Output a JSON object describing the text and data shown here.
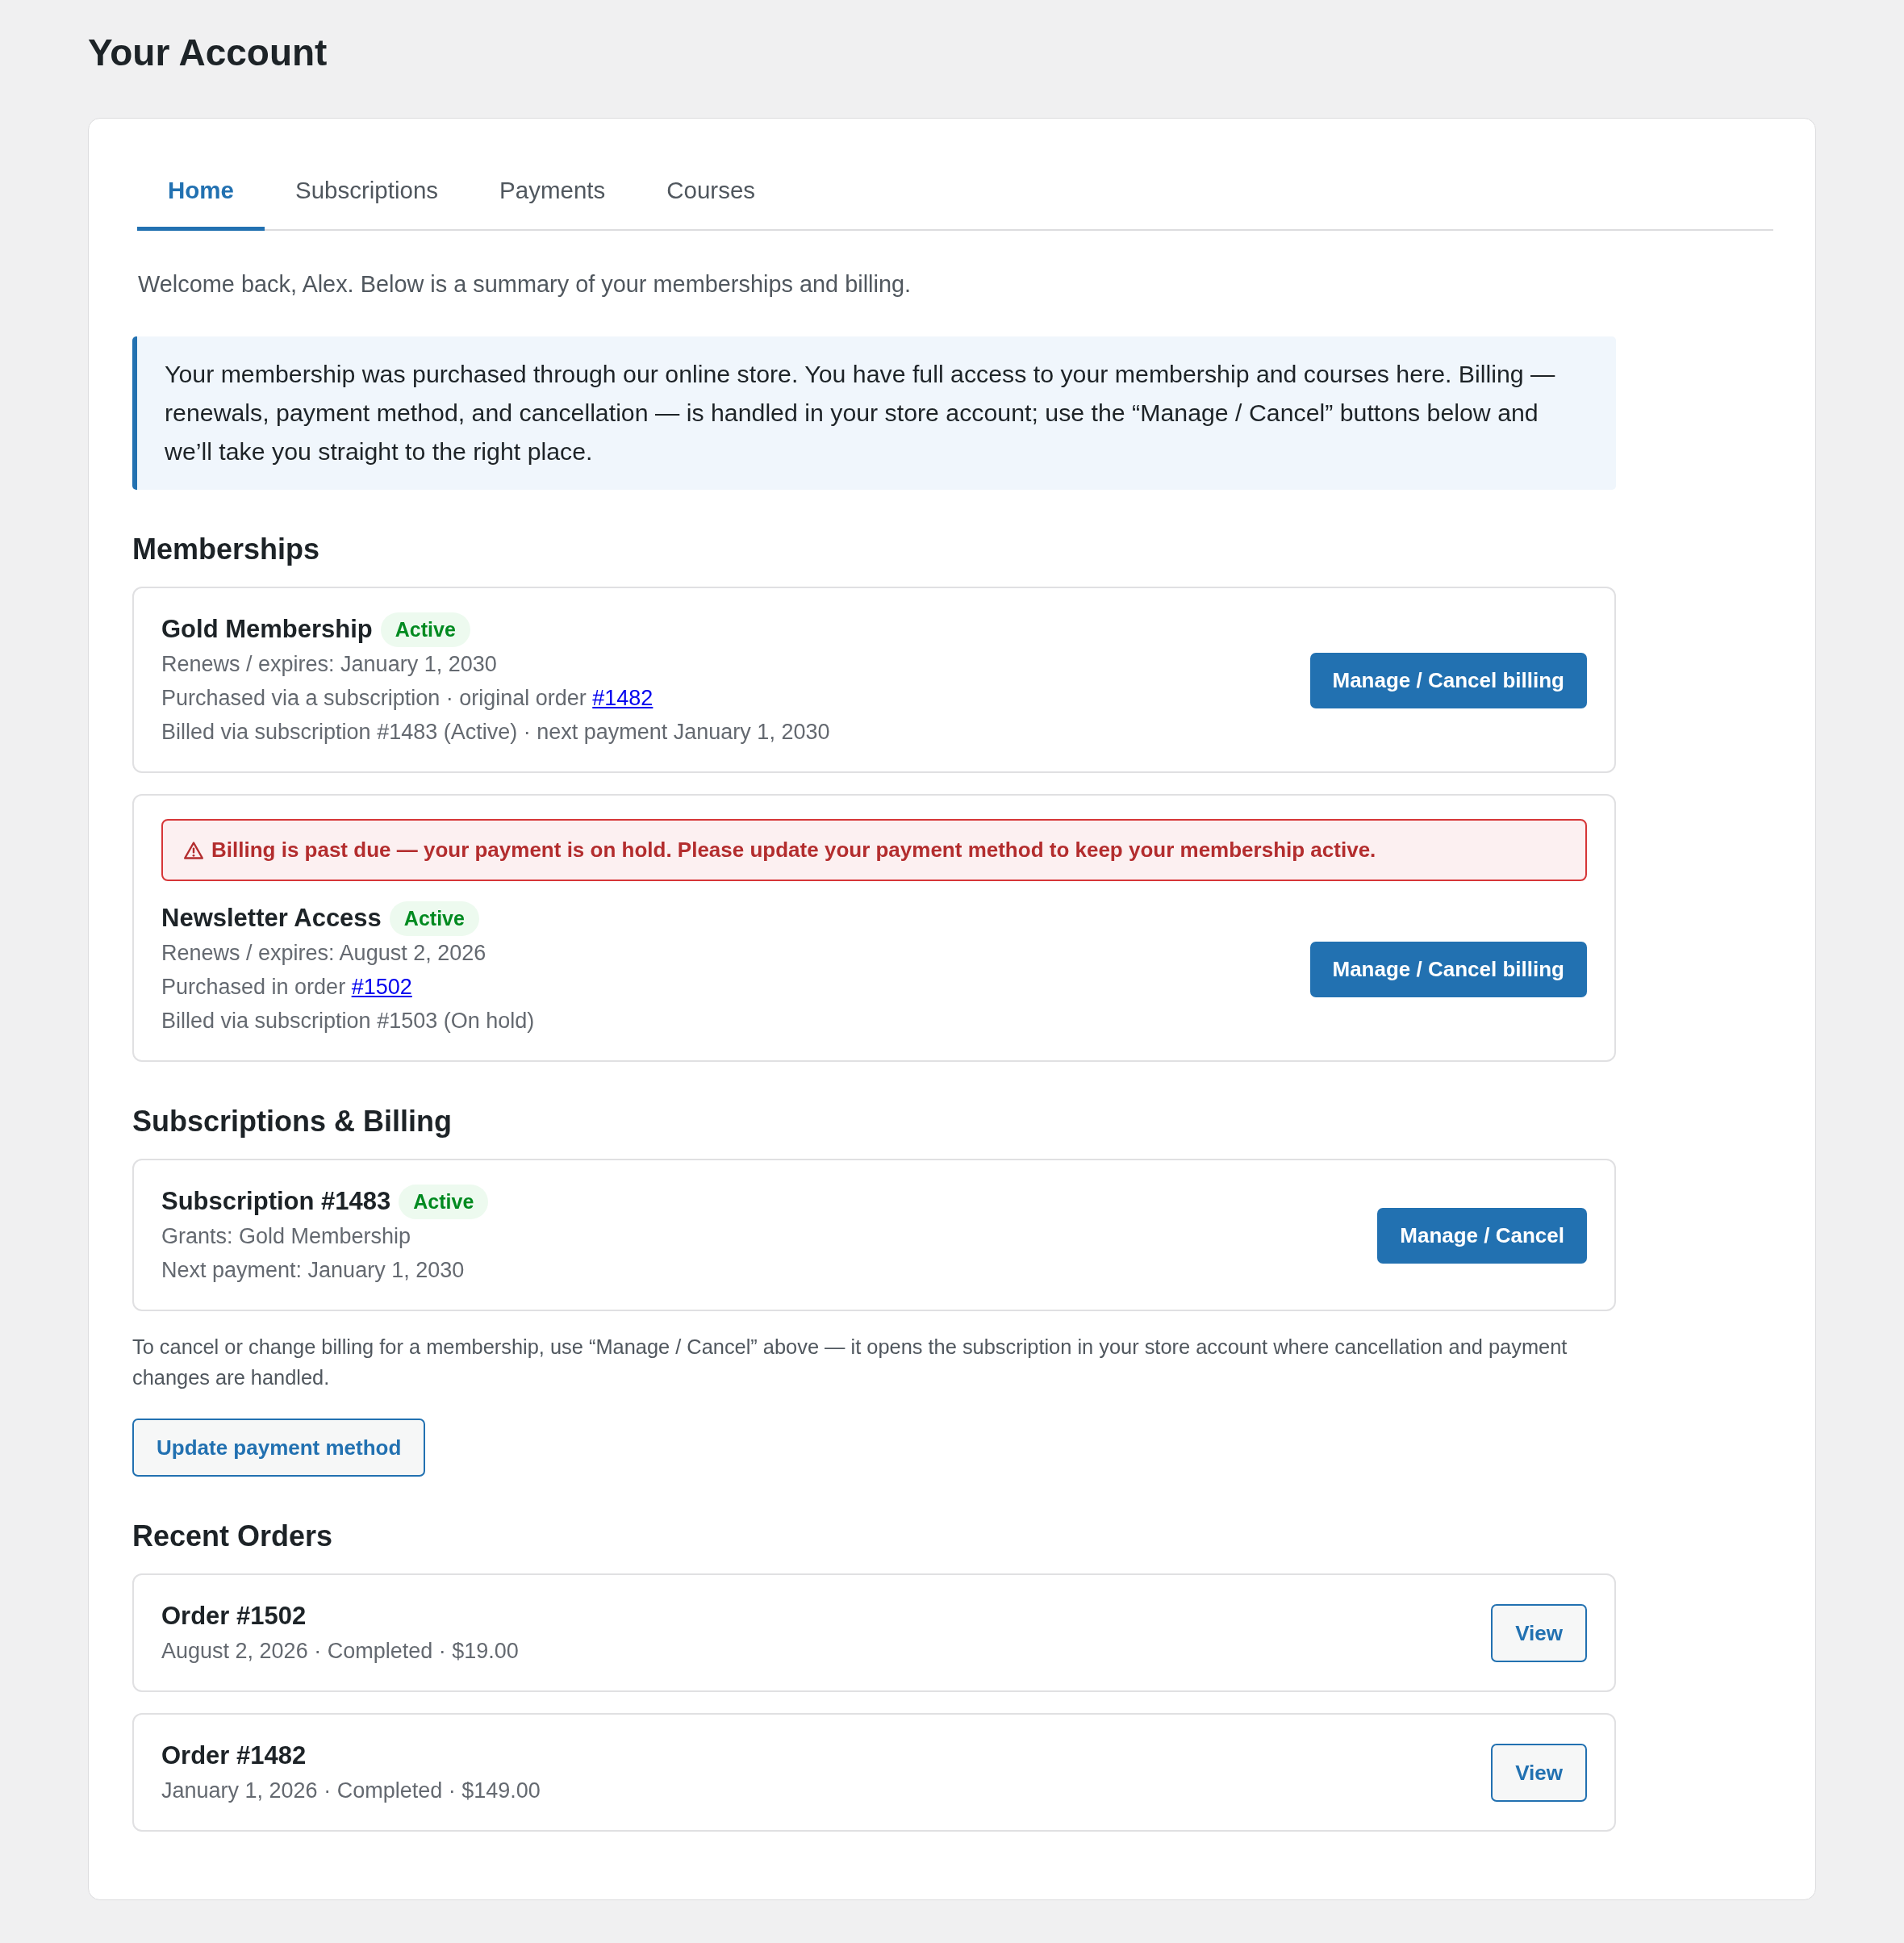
{
  "page": {
    "title": "Your Account"
  },
  "tabs": [
    {
      "label": "Home",
      "selected": true
    },
    {
      "label": "Subscriptions",
      "selected": false
    },
    {
      "label": "Payments",
      "selected": false
    },
    {
      "label": "Courses",
      "selected": false
    }
  ],
  "intro": "Welcome back, Alex. Below is a summary of your memberships and billing.",
  "notice": "Your membership was purchased through our online store. You have full access to your membership and courses here. Billing — renewals, payment method, and cancellation — is handled in your store account; use the “Manage / Cancel” buttons below and we’ll take you straight to the right place.",
  "memberships": {
    "heading": "Memberships",
    "items": [
      {
        "name": "Gold Membership",
        "status": "Active",
        "lines": [
          {
            "text": "Renews / expires: January 1, 2030"
          },
          {
            "text": "Purchased via a subscription · original order",
            "link": "#1482"
          },
          {
            "text": "Billed via subscription #1483 (Active) · next payment January 1, 2030"
          }
        ],
        "button": "Manage / Cancel billing"
      },
      {
        "alert": "Billing is past due — your payment is on hold. Please update your payment method to keep your membership active.",
        "name": "Newsletter Access",
        "status": "Active",
        "lines": [
          {
            "text": "Renews / expires: August 2, 2026"
          },
          {
            "text": "Purchased in order",
            "link": "#1502"
          },
          {
            "text": "Billed via subscription #1503 (On hold)"
          }
        ],
        "button": "Manage / Cancel billing"
      }
    ]
  },
  "subscriptions": {
    "heading": "Subscriptions & Billing",
    "items": [
      {
        "name": "Subscription #1483",
        "status": "Active",
        "lines": [
          {
            "text": "Grants: Gold Membership"
          },
          {
            "text": "Next payment: January 1, 2030"
          }
        ],
        "button": "Manage / Cancel"
      }
    ],
    "note": "To cancel or change billing for a membership, use “Manage / Cancel” above — it opens the subscription in your store account where cancellation and payment changes are handled.",
    "update_button": "Update payment method"
  },
  "orders": {
    "heading": "Recent Orders",
    "items": [
      {
        "name": "Order #1502",
        "details": "August 2, 2026 · Completed · $19.00",
        "button": "View"
      },
      {
        "name": "Order #1482",
        "details": "January 1, 2026 · Completed · $149.00",
        "button": "View"
      }
    ]
  }
}
